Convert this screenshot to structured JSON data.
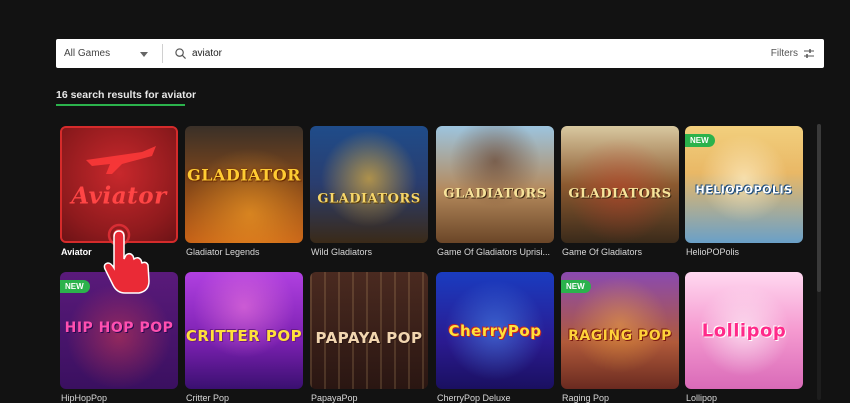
{
  "search": {
    "category_label": "All Games",
    "query": "aviator",
    "filters_label": "Filters"
  },
  "results": {
    "summary": "16 search results for aviator"
  },
  "badge_new": "NEW",
  "games_row1": [
    {
      "name": "Aviator",
      "logo": "Aviator",
      "new": false
    },
    {
      "name": "Gladiator Legends",
      "logo": "GLADIATOR",
      "new": false
    },
    {
      "name": "Wild Gladiators",
      "logo": "GLADIATORS",
      "new": false
    },
    {
      "name": "Game Of Gladiators Uprisi...",
      "logo": "GLADIATORS",
      "new": false
    },
    {
      "name": "Game Of Gladiators",
      "logo": "GLADIATORS",
      "new": false
    },
    {
      "name": "HelioPOPolis",
      "logo": "HELIOPOPOLIS",
      "new": true
    }
  ],
  "games_row2": [
    {
      "name": "HipHopPop",
      "logo": "HIP HOP POP",
      "new": true
    },
    {
      "name": "Critter Pop",
      "logo": "CRITTER POP",
      "new": false
    },
    {
      "name": "PapayaPop",
      "logo": "PAPAYA POP",
      "new": false
    },
    {
      "name": "CherryPop Deluxe",
      "logo": "CherryPop",
      "new": false
    },
    {
      "name": "Raging Pop",
      "logo": "RAGING POP",
      "new": true
    },
    {
      "name": "Lollipop",
      "logo": "Lollipop",
      "new": false
    }
  ]
}
